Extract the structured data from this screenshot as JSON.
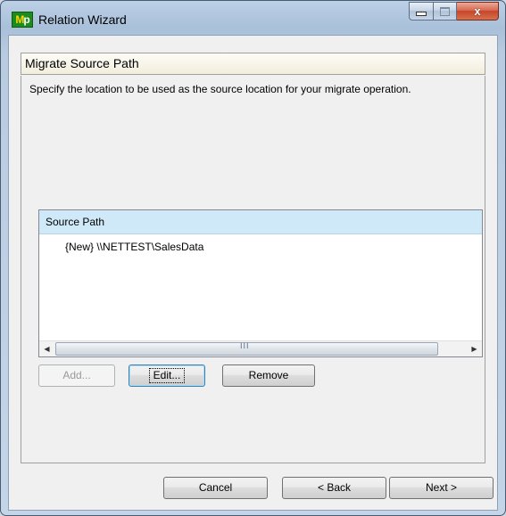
{
  "window": {
    "title": "Relation Wizard",
    "logo_m": "M",
    "logo_p": "p",
    "minimize_icon": "minimize-icon",
    "maximize_icon": "maximize-icon",
    "close_icon": "close-icon",
    "close_glyph": "x"
  },
  "page": {
    "title": "Migrate Source Path",
    "description": "Specify the location to be used as the source location for your migrate operation."
  },
  "list": {
    "columns": [
      "Source Path"
    ],
    "rows": [
      "{New} \\\\NETTEST\\SalesData"
    ],
    "scroll_left_glyph": "◀",
    "scroll_right_glyph": "▶",
    "scroll_grip": "III"
  },
  "actions": {
    "add_label": "Add...",
    "edit_label": "Edit...",
    "remove_label": "Remove"
  },
  "footer": {
    "cancel_label": "Cancel",
    "back_label": "< Back",
    "next_label": "Next >"
  },
  "colors": {
    "header_band": "#cfe9f8",
    "close_button": "#c7452a",
    "logo_bg": "#1c8d1c"
  }
}
